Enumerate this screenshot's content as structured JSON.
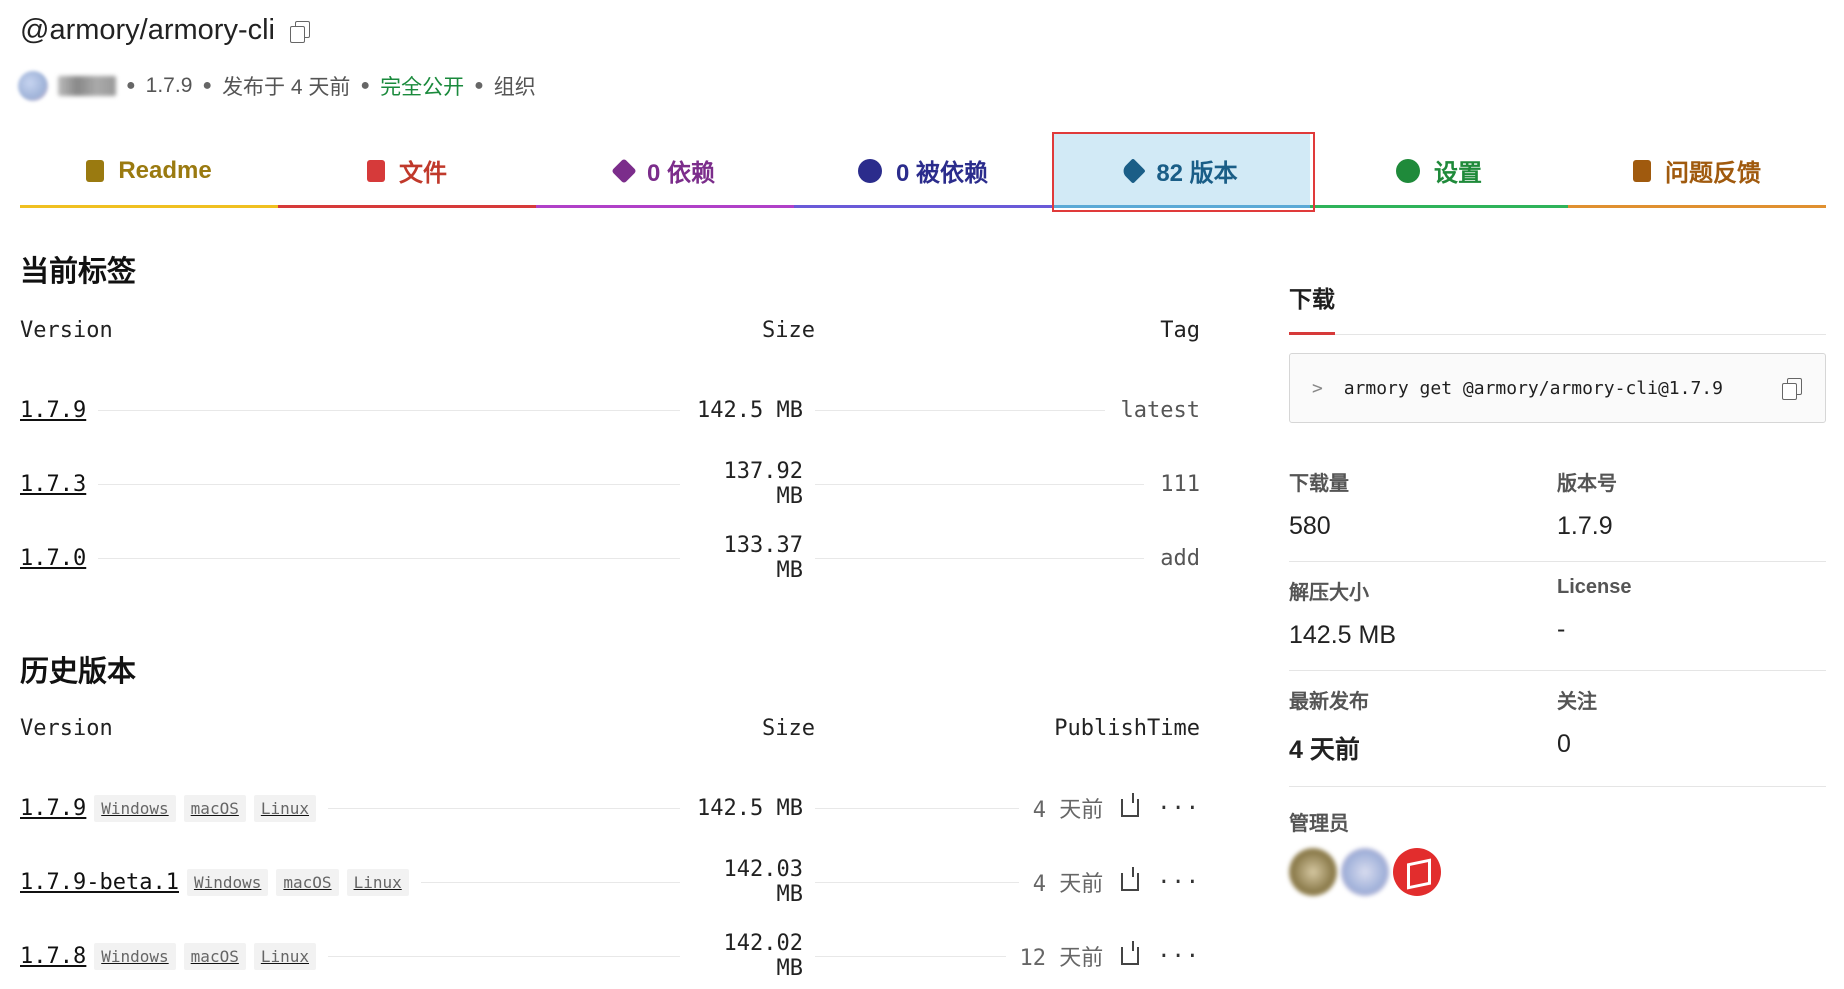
{
  "package": {
    "name": "@armory/armory-cli",
    "version": "1.7.9",
    "published": "发布于 4 天前",
    "visibility": "完全公开",
    "scope": "组织"
  },
  "tabs": [
    {
      "label": "Readme",
      "color": "#9a7a10",
      "icon": "readme-icon"
    },
    {
      "label": "文件",
      "color": "#c0392b",
      "icon": "file-icon"
    },
    {
      "label": "0 依赖",
      "color": "#7b2d8b",
      "icon": "package-icon"
    },
    {
      "label": "0 被依赖",
      "color": "#2b2c8c",
      "icon": "dependents-icon"
    },
    {
      "label": "82 版本",
      "color": "#1a5e87",
      "icon": "tags-icon",
      "active": true
    },
    {
      "label": "设置",
      "color": "#1f8a3a",
      "icon": "gear-icon"
    },
    {
      "label": "问题反馈",
      "color": "#a05a0e",
      "icon": "issue-icon"
    }
  ],
  "current_tags": {
    "heading": "当前标签",
    "columns": {
      "version": "Version",
      "size": "Size",
      "tag": "Tag"
    },
    "rows": [
      {
        "version": "1.7.9",
        "size": "142.5 MB",
        "tag": "latest"
      },
      {
        "version": "1.7.3",
        "size": "137.92 MB",
        "tag": "111"
      },
      {
        "version": "1.7.0",
        "size": "133.37 MB",
        "tag": "add"
      }
    ]
  },
  "history": {
    "heading": "历史版本",
    "columns": {
      "version": "Version",
      "size": "Size",
      "time": "PublishTime"
    },
    "rows": [
      {
        "version": "1.7.9",
        "os": [
          "Windows",
          "macOS",
          "Linux"
        ],
        "size": "142.5 MB",
        "time": "4 天前"
      },
      {
        "version": "1.7.9-beta.1",
        "os": [
          "Windows",
          "macOS",
          "Linux"
        ],
        "size": "142.03 MB",
        "time": "4 天前"
      },
      {
        "version": "1.7.8",
        "os": [
          "Windows",
          "macOS",
          "Linux"
        ],
        "size": "142.02 MB",
        "time": "12 天前"
      }
    ],
    "more": "···"
  },
  "sidebar": {
    "tab": "下载",
    "command_prompt": ">",
    "command": "armory get @armory/armory-cli@1.7.9",
    "stats": {
      "downloads_label": "下载量",
      "downloads": "580",
      "version_label": "版本号",
      "version": "1.7.9",
      "unpacked_label": "解压大小",
      "unpacked": "142.5 MB",
      "license_label": "License",
      "license": "-",
      "latest_label": "最新发布",
      "latest": "4 天前",
      "follow_label": "关注",
      "follow": "0"
    },
    "admins_label": "管理员"
  },
  "colors": {
    "accent_red": "#d63a3a",
    "active_tab_bg": "#d2eaf6",
    "public_green": "#1a8a3c"
  }
}
